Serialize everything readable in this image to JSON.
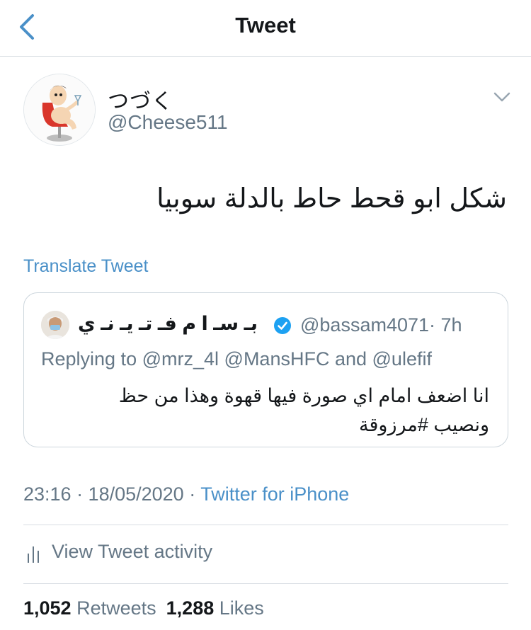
{
  "nav": {
    "title": "Tweet",
    "back_icon": "chevron-left-icon"
  },
  "tweet": {
    "author_name": "つづく",
    "author_handle": "@Cheese511",
    "text": "شكل ابو قحط حاط بالدلة سوبيا",
    "translate_label": "Translate Tweet",
    "timestamp": "23:16 · 18/05/2020 · ",
    "source": "Twitter for iPhone"
  },
  "quote": {
    "author_name": "بـ سـ ا م فـ تـ يـ نـ ي",
    "author_handle": "@bassam4071",
    "age": "· 7h",
    "replying_prefix": "Replying to ",
    "mentions": [
      "@mrz_4l",
      "@MansHFC",
      "@ulefif"
    ],
    "replying_sep": " and ",
    "text": "انا اضعف امام اي صورة فيها قهوة وهذا من حظ ونصيب #مرزوقة"
  },
  "activity": {
    "label": "View Tweet activity"
  },
  "stats": {
    "retweets_count": "1,052",
    "retweets_label": "Retweets",
    "likes_count": "1,288",
    "likes_label": "Likes"
  },
  "colors": {
    "link_blue": "#4a90c8",
    "secondary_text": "#657786",
    "primary_text": "#14171a",
    "divider": "#d8dde2",
    "verified_blue": "#1da1f2"
  }
}
